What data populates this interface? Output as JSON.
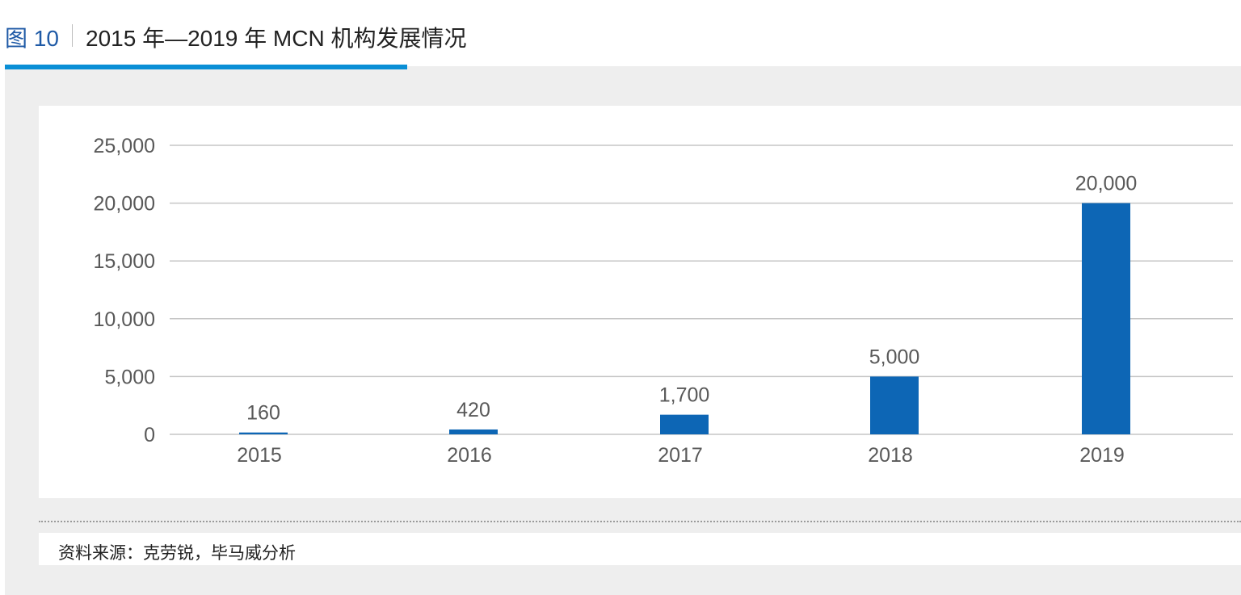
{
  "figure": {
    "label": "图 10",
    "title": "2015 年—2019 年 MCN 机构发展情况",
    "source": "资料来源：克劳锐，毕马威分析"
  },
  "colors": {
    "bar": "#0d66b5",
    "gridline": "#c6c6c6",
    "axis_text": "#595959",
    "accent": "#0a8fd6",
    "panel_bg": "#eeeeee"
  },
  "chart_data": {
    "type": "bar",
    "categories": [
      "2015",
      "2016",
      "2017",
      "2018",
      "2019"
    ],
    "values": [
      160,
      420,
      1700,
      5000,
      20000
    ],
    "value_labels": [
      "160",
      "420",
      "1,700",
      "5,000",
      "20,000"
    ],
    "yticks": [
      0,
      5000,
      10000,
      15000,
      20000,
      25000
    ],
    "ytick_labels": [
      "0",
      "5,000",
      "10,000",
      "15,000",
      "20,000",
      "25,000"
    ],
    "ylim": [
      0,
      25000
    ],
    "grid": true,
    "legend": "none"
  }
}
